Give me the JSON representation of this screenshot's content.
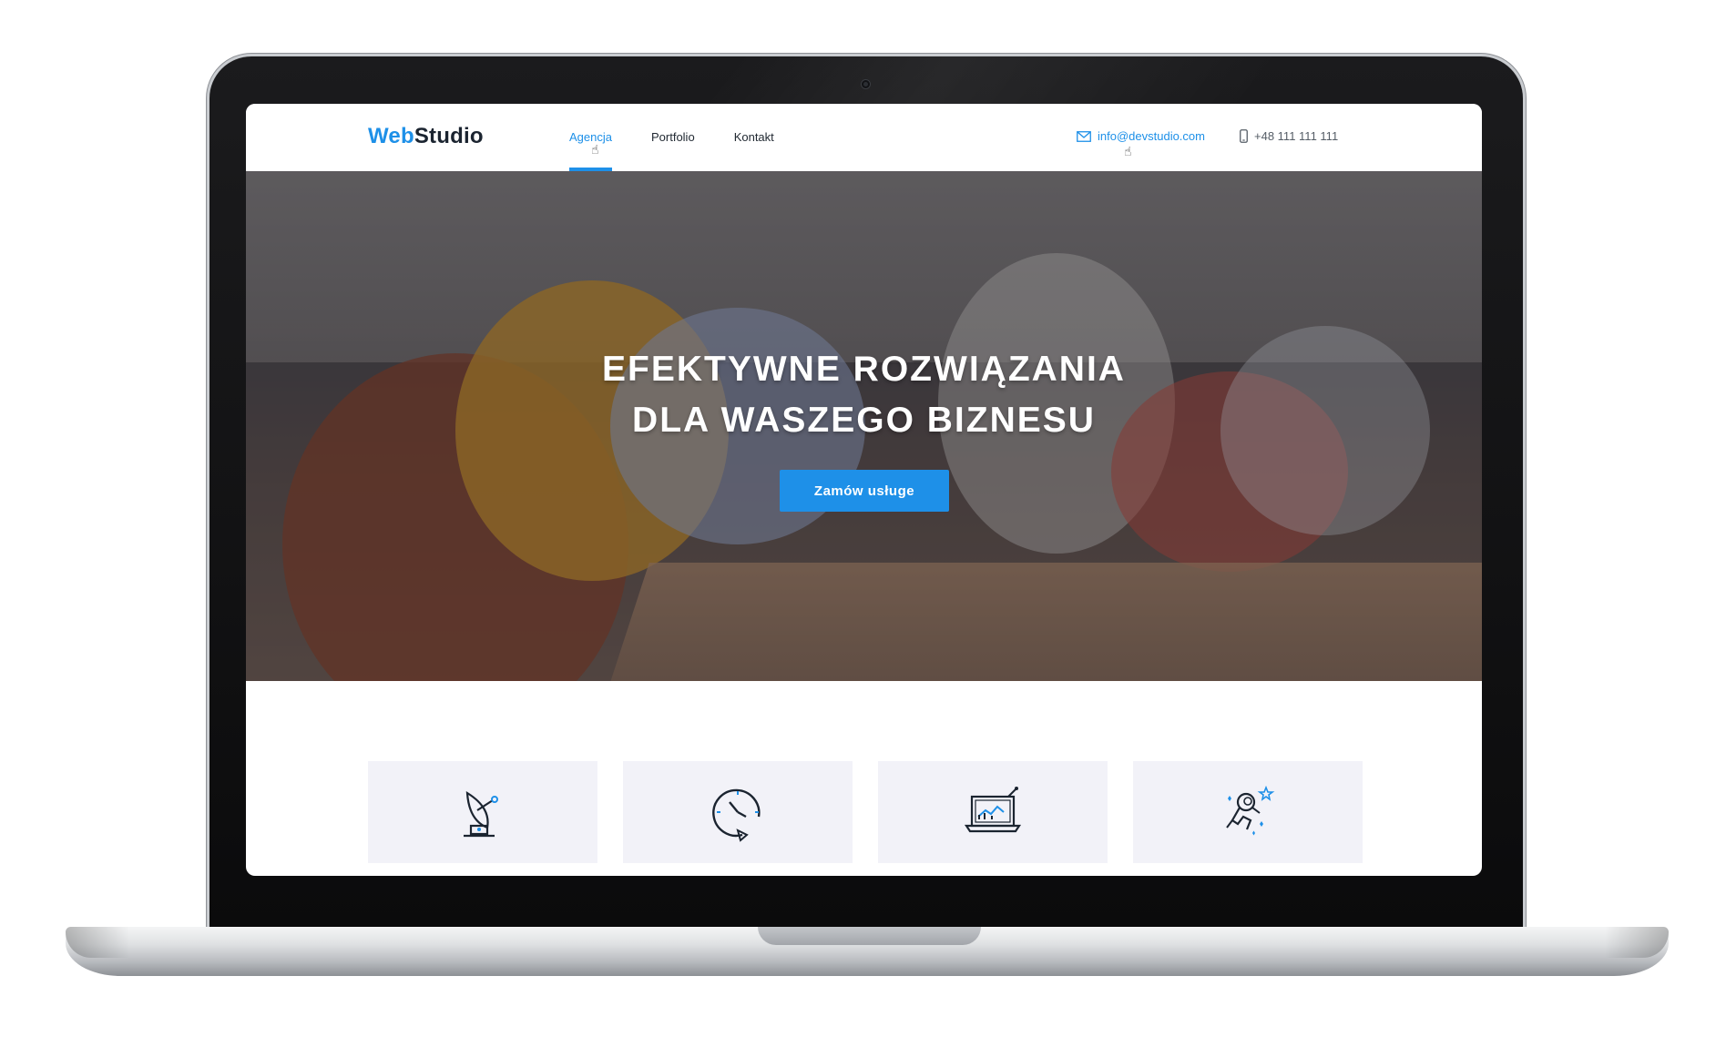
{
  "site": {
    "logo": {
      "part1": "Web",
      "part2": "Studio"
    },
    "nav": [
      {
        "label": "Agencja",
        "active": true
      },
      {
        "label": "Portfolio",
        "active": false
      },
      {
        "label": "Kontakt",
        "active": false
      }
    ],
    "contact": {
      "email": "info@devstudio.com",
      "phone": "+48 111 111 111",
      "email_icon": "envelope-icon",
      "phone_icon": "mobile-phone-icon"
    }
  },
  "hero": {
    "title_line1": "EFEKTYWNE ROZWIĄZANIA",
    "title_line2": "DLA WASZEGO BIZNESU",
    "cta_label": "Zamów usługe"
  },
  "features": {
    "icons": [
      "satellite-dish-icon",
      "clock-cycle-icon",
      "laptop-chart-icon",
      "astronaut-icon"
    ]
  },
  "colors": {
    "accent": "#1e90e8",
    "text_dark": "#1b2430",
    "card_bg": "#f2f2f8"
  }
}
